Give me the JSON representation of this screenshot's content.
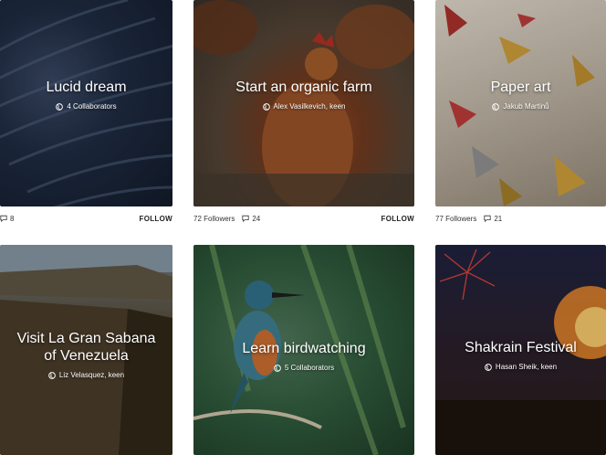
{
  "cards": [
    {
      "title": "Lucid dream",
      "collab": "4 Collaborators"
    },
    {
      "title": "Start an organic farm",
      "collab": "Alex Vasilkevich, keen"
    },
    {
      "title": "Paper art",
      "collab": "Jakub Martinů"
    },
    {
      "title": "Visit La Gran Sabana of Venezuela",
      "collab": "Liz Velasquez, keen"
    },
    {
      "title": "Learn birdwatching",
      "collab": "5 Collaborators"
    },
    {
      "title": "Shakrain Festival",
      "collab": "Hasan Sheik, keen"
    }
  ],
  "meta": [
    {
      "comments": "8",
      "follow": "FOLLOW"
    },
    {
      "followers": "72 Followers",
      "comments": "24",
      "follow": "FOLLOW"
    },
    {
      "followers": "77 Followers",
      "comments": "21"
    }
  ],
  "colors": {
    "accent_text": "#222222",
    "overlay": "#ffffff"
  }
}
